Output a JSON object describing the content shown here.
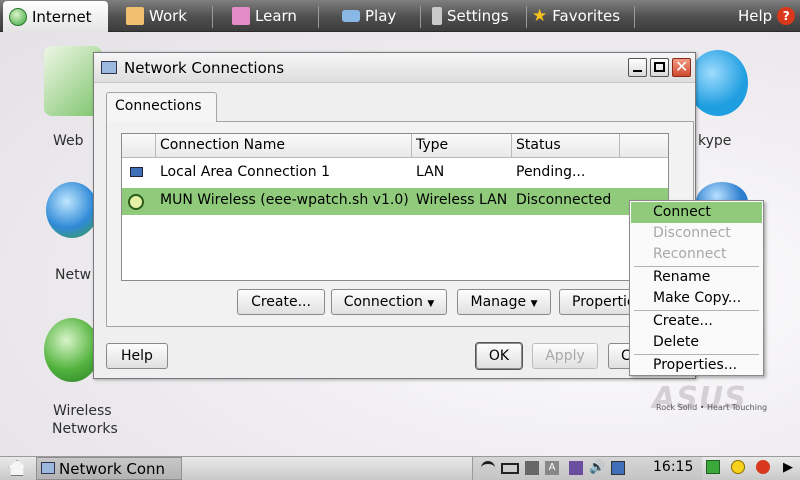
{
  "top_tabs": [
    {
      "label": "Internet",
      "active": true
    },
    {
      "label": "Work"
    },
    {
      "label": "Learn"
    },
    {
      "label": "Play"
    },
    {
      "label": "Settings"
    },
    {
      "label": "Favorites"
    },
    {
      "label": "Help"
    }
  ],
  "desktop": {
    "web_label": "Web",
    "network_label": "Netw",
    "wireless_label_1": "Wireless",
    "wireless_label_2": "Networks",
    "skype_label": "kype"
  },
  "dialog": {
    "title": "Network Connections",
    "tab_label": "Connections",
    "columns": [
      "Connection Name",
      "Type",
      "Status"
    ],
    "rows": [
      {
        "name": "Local Area Connection 1",
        "type": "LAN",
        "status": "Pending..."
      },
      {
        "name": "MUN Wireless (eee-wpatch.sh v1.0)",
        "type": "Wireless LAN",
        "status": "Disconnected"
      }
    ],
    "buttons": {
      "create": "Create...",
      "connection": "Connection",
      "manage": "Manage",
      "properties": "Properties",
      "help": "Help",
      "ok": "OK",
      "apply": "Apply",
      "close": "C"
    }
  },
  "context_menu": {
    "connect": "Connect",
    "disconnect": "Disconnect",
    "reconnect": "Reconnect",
    "rename": "Rename",
    "make_copy": "Make Copy...",
    "create": "Create...",
    "delete": "Delete",
    "properties": "Properties..."
  },
  "asus": {
    "logo": "ASUS",
    "tagline": "Rock Solid • Heart Touching"
  },
  "taskbar": {
    "window_label": "Network Conn",
    "clock": "16:15"
  },
  "colors": {
    "selection": "#8fcb7b",
    "topbar": "#4f4f4f"
  }
}
